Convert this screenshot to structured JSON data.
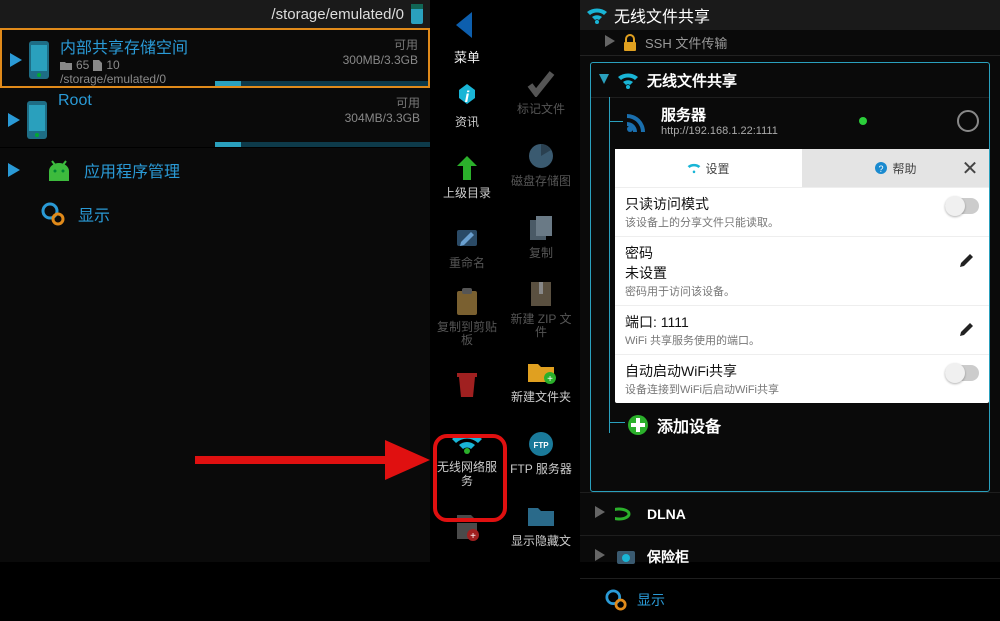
{
  "left": {
    "path": "/storage/emulated/0",
    "items": [
      {
        "title": "内部共享存储空间",
        "folders": "65",
        "files": "10",
        "subpath": "/storage/emulated/0",
        "avail_lbl": "可用",
        "avail_val": "300MB/3.3GB"
      },
      {
        "title": "Root",
        "avail_lbl": "可用",
        "avail_val": "304MB/3.3GB"
      }
    ],
    "app_mgr": "应用程序管理",
    "display": "显示"
  },
  "mid": {
    "menu": "菜单",
    "left_col": [
      "资讯",
      "上级目录",
      "重命名",
      "复制到剪贴板",
      "",
      "无线网络服务",
      ""
    ],
    "right_col": [
      "标记文件",
      "磁盘存储图",
      "复制",
      "新建 ZIP 文件",
      "新建文件夹",
      "FTP 服务器",
      "显示隐藏文"
    ]
  },
  "right": {
    "title": "无线文件共享",
    "ssh": "SSH 文件传输",
    "section_title": "无线文件共享",
    "server": {
      "label": "服务器",
      "url": "http://192.168.1.22:1111"
    },
    "tabs": {
      "settings": "设置",
      "help": "帮助"
    },
    "rows": {
      "readonly_t": "只读访问模式",
      "readonly_s": "该设备上的分享文件只能读取。",
      "pw_t": "密码",
      "pw_val": "未设置",
      "pw_s": "密码用于访问该设备。",
      "port_t": "端口: 1111",
      "port_s": "WiFi 共享服务使用的端口。",
      "auto_t": "自动启动WiFi共享",
      "auto_s": "设备连接到WiFi后启动WiFi共享"
    },
    "add_device": "添加设备",
    "dlna": "DLNA",
    "safe": "保险柜",
    "display": "显示"
  }
}
